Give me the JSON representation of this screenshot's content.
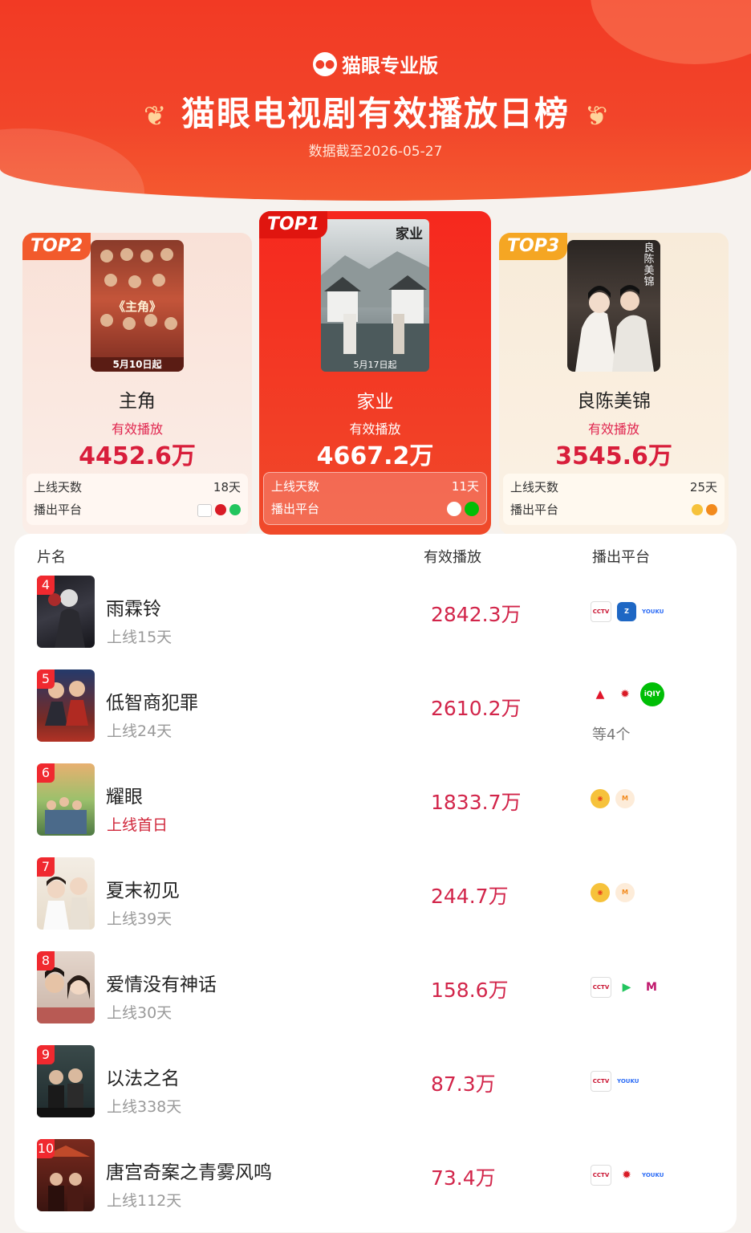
{
  "header": {
    "brand": "猫眼专业版",
    "title": "猫眼电视剧有效播放日榜",
    "date_line": "数据截至2026-05-27"
  },
  "top3": [
    {
      "tag": "TOP2",
      "title": "主角",
      "metric_label": "有效播放",
      "value": "4452.6万",
      "days_label": "上线天数",
      "days": "18天",
      "platform_label": "播出平台",
      "poster_text": "《主角》",
      "poster_date": "5月10日起",
      "platforms": [
        "cctv",
        "dragon",
        "tencent"
      ]
    },
    {
      "tag": "TOP1",
      "title": "家业",
      "metric_label": "有效播放",
      "value": "4667.2万",
      "days_label": "上线天数",
      "days": "11天",
      "platform_label": "播出平台",
      "poster_text": "家业",
      "poster_date": "5月17日起",
      "platforms": [
        "cctv",
        "iqiyi"
      ]
    },
    {
      "tag": "TOP3",
      "title": "良陈美锦",
      "metric_label": "有效播放",
      "value": "3545.6万",
      "days_label": "上线天数",
      "days": "25天",
      "platform_label": "播出平台",
      "poster_text": "良陈美锦",
      "platforms": [
        "hunan",
        "mgtv"
      ]
    }
  ],
  "list": {
    "columns": [
      "片名",
      "有效播放",
      "播出平台"
    ],
    "rows": [
      {
        "rank": "4",
        "name": "雨霖铃",
        "days": "上线15天",
        "value": "2842.3万",
        "platforms": [
          "cctv",
          "zj",
          "youku"
        ],
        "more": ""
      },
      {
        "rank": "5",
        "name": "低智商犯罪",
        "days": "上线24天",
        "value": "2610.2万",
        "platforms": [
          "hb",
          "dragon",
          "iqiyi"
        ],
        "more": "等4个"
      },
      {
        "rank": "6",
        "name": "耀眼",
        "days": "上线首日",
        "value": "1833.7万",
        "platforms": [
          "hunan",
          "mgtv"
        ],
        "more": ""
      },
      {
        "rank": "7",
        "name": "夏末初见",
        "days": "上线39天",
        "value": "244.7万",
        "platforms": [
          "hunan",
          "mgtv"
        ],
        "more": ""
      },
      {
        "rank": "8",
        "name": "爱情没有神话",
        "days": "上线30天",
        "value": "158.6万",
        "platforms": [
          "cctv",
          "tencent",
          "migu"
        ],
        "more": ""
      },
      {
        "rank": "9",
        "name": "以法之名",
        "days": "上线338天",
        "value": "87.3万",
        "platforms": [
          "cctv",
          "youku"
        ],
        "more": ""
      },
      {
        "rank": "10",
        "name": "唐宫奇案之青雾风鸣",
        "days": "上线112天",
        "value": "73.4万",
        "platforms": [
          "cctv",
          "dragon",
          "youku"
        ],
        "more": ""
      }
    ]
  },
  "colors": {
    "accent_red": "#f23a24",
    "value_red": "#d2254a",
    "gold": "#f5a623"
  }
}
